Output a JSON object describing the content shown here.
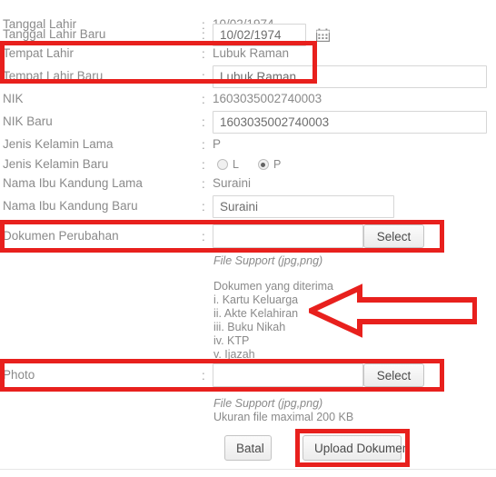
{
  "form": {
    "colon": ":",
    "rows": [
      {
        "label": "Tanggal Lahir",
        "value": "10/02/1974"
      },
      {
        "label": "Tanggal Lahir Baru",
        "value": "10/02/1974"
      },
      {
        "label": "Tempat Lahir",
        "value": "Lubuk Raman"
      },
      {
        "label": "Tempat Lahir Baru",
        "value": "Lubuk Raman"
      },
      {
        "label": "NIK",
        "value": "1603035002740003"
      },
      {
        "label": "NIK Baru",
        "value": "1603035002740003"
      },
      {
        "label": "Jenis Kelamin Lama",
        "value": "P"
      },
      {
        "label": "Jenis Kelamin Baru",
        "value": ""
      },
      {
        "label": "Nama Ibu Kandung Lama",
        "value": "Suraini"
      },
      {
        "label": "Nama Ibu Kandung Baru",
        "value": "Suraini"
      },
      {
        "label": "Dokumen Perubahan",
        "value": ""
      },
      {
        "label": "Photo",
        "value": ""
      }
    ]
  },
  "gender": {
    "options": [
      {
        "label": "L",
        "selected": false
      },
      {
        "label": "P",
        "selected": true
      }
    ]
  },
  "upload": {
    "select_label": "Select",
    "document_input_placeholder": "",
    "photo_input_placeholder": "",
    "file_support": "File Support (jpg,png)",
    "accepted_heading": "Dokumen yang diterima",
    "accepted_items": [
      "i. Kartu Keluarga",
      "ii. Akte Kelahiran",
      "iii. Buku Nikah",
      "iv. KTP",
      "v. Ijazah"
    ],
    "photo_file_support": "File Support (jpg,png)",
    "photo_max_size": "Ukuran file maximal 200 KB"
  },
  "actions": {
    "cancel_label": "Batal",
    "submit_label": "Upload Dokumen"
  },
  "icons": {
    "calendar": "calendar-icon",
    "arrow": "left-arrow-annotation"
  },
  "colors": {
    "annotation": "#e8201d",
    "label_text": "#8a8a8a",
    "input_border": "#d6d6d6",
    "button_face": "#ececec"
  }
}
